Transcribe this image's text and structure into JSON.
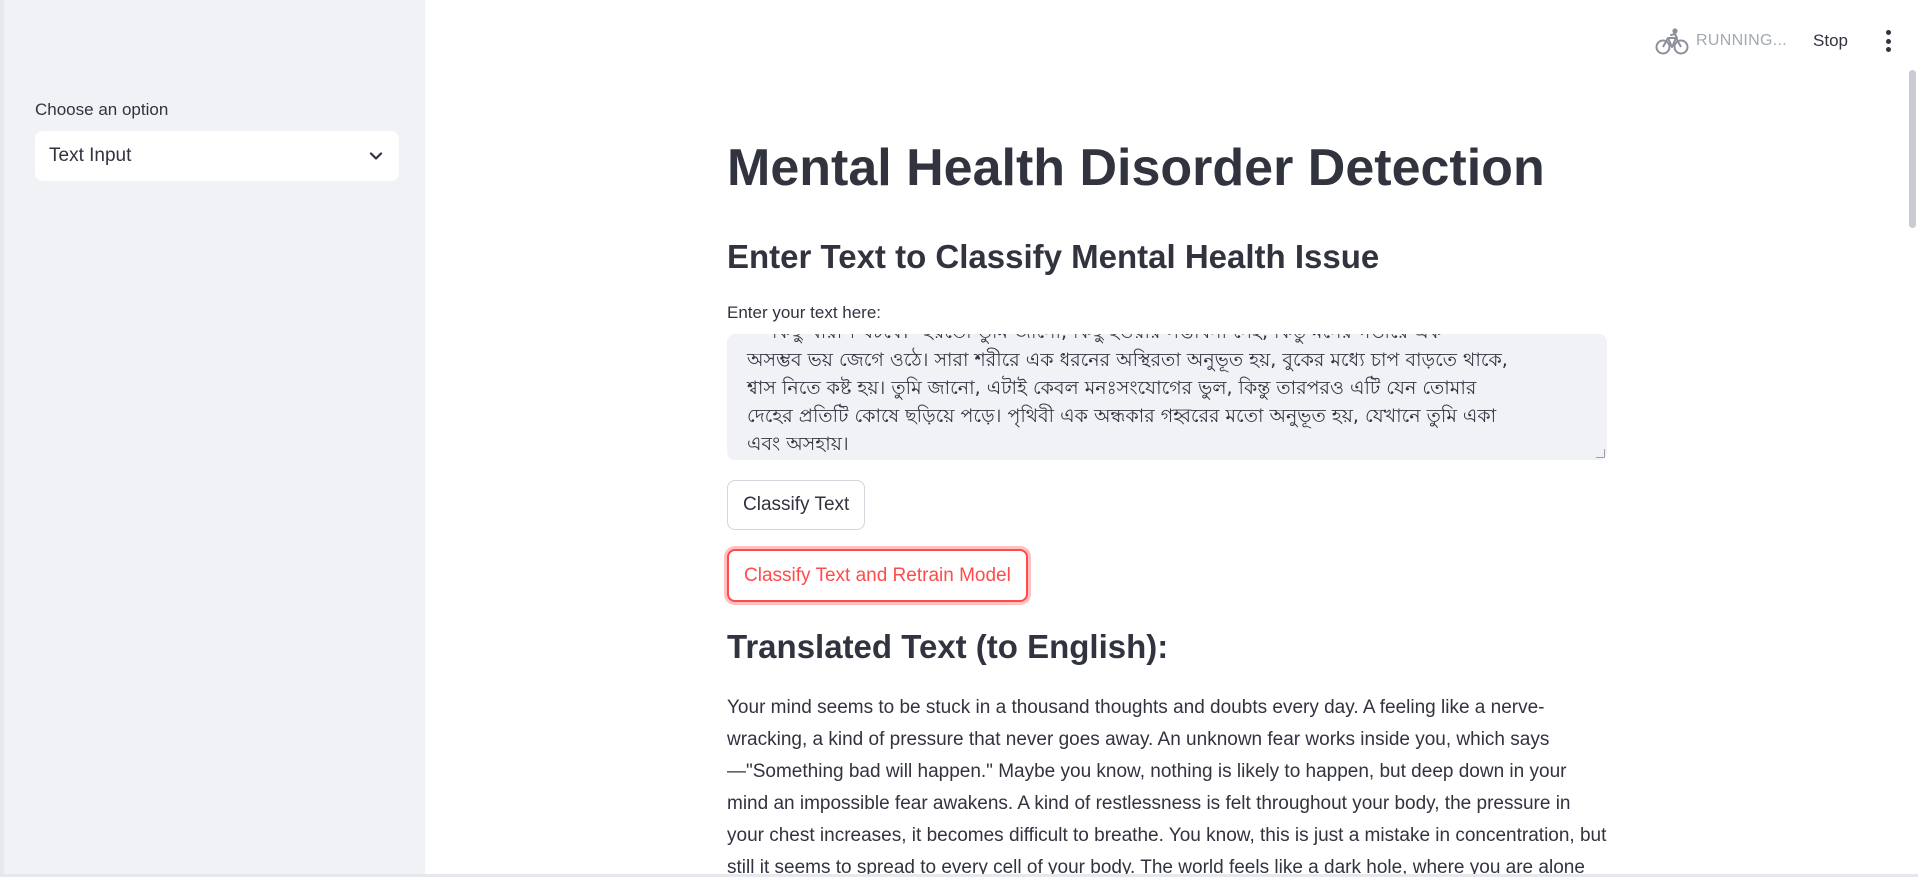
{
  "sidebar": {
    "select_label": "Choose an option",
    "select_value": "Text Input"
  },
  "header": {
    "status_text": "RUNNING...",
    "stop_label": "Stop"
  },
  "main": {
    "title": "Mental Health Disorder Detection",
    "subheader": "Enter Text to Classify Mental Health Issue",
    "input_label": "Enter your text here:",
    "input_lines": [
      "— কিছু খারাপ ঘটবে।\" হয়তো তুমি জানো, কিছু হওয়ার সম্ভাবনা নেই, কিন্তু মনের গভীরে এক",
      "অসম্ভব ভয় জেগে ওঠে। সারা শরীরে এক ধরনের অস্থিরতা অনুভূত হয়, বুকের মধ্যে চাপ বাড়তে থাকে,",
      "শ্বাস নিতে কষ্ট হয়। তুমি জানো, এটাই কেবল মনঃসংযোগের ভুল, কিন্তু তারপরও এটি যেন তোমার",
      "দেহের প্রতিটি কোষে ছড়িয়ে পড়ে। পৃথিবী এক অন্ধকার গহ্বরের মতো অনুভূত হয়, যেখানে তুমি একা",
      "এবং অসহায়।"
    ],
    "classify_button": "Classify Text",
    "retrain_button": "Classify Text and Retrain Model",
    "translated_title": "Translated Text (to English):",
    "translated_text": "Your mind seems to be stuck in a thousand thoughts and doubts every day. A feeling like a nerve-wracking, a kind of pressure that never goes away. An unknown fear works inside you, which says —\"Something bad will happen.\" Maybe you know, nothing is likely to happen, but deep down in your mind an impossible fear awakens. A kind of restlessness is felt throughout your body, the pressure in your chest increases, it becomes difficult to breathe. You know, this is just a mistake in concentration, but still it seems to spread to every cell of your body. The world feels like a dark hole, where you are alone and helpless."
  },
  "colors": {
    "primary": "#ff4b4b",
    "sidebar_bg": "#f0f2f6",
    "text": "#31333f"
  }
}
